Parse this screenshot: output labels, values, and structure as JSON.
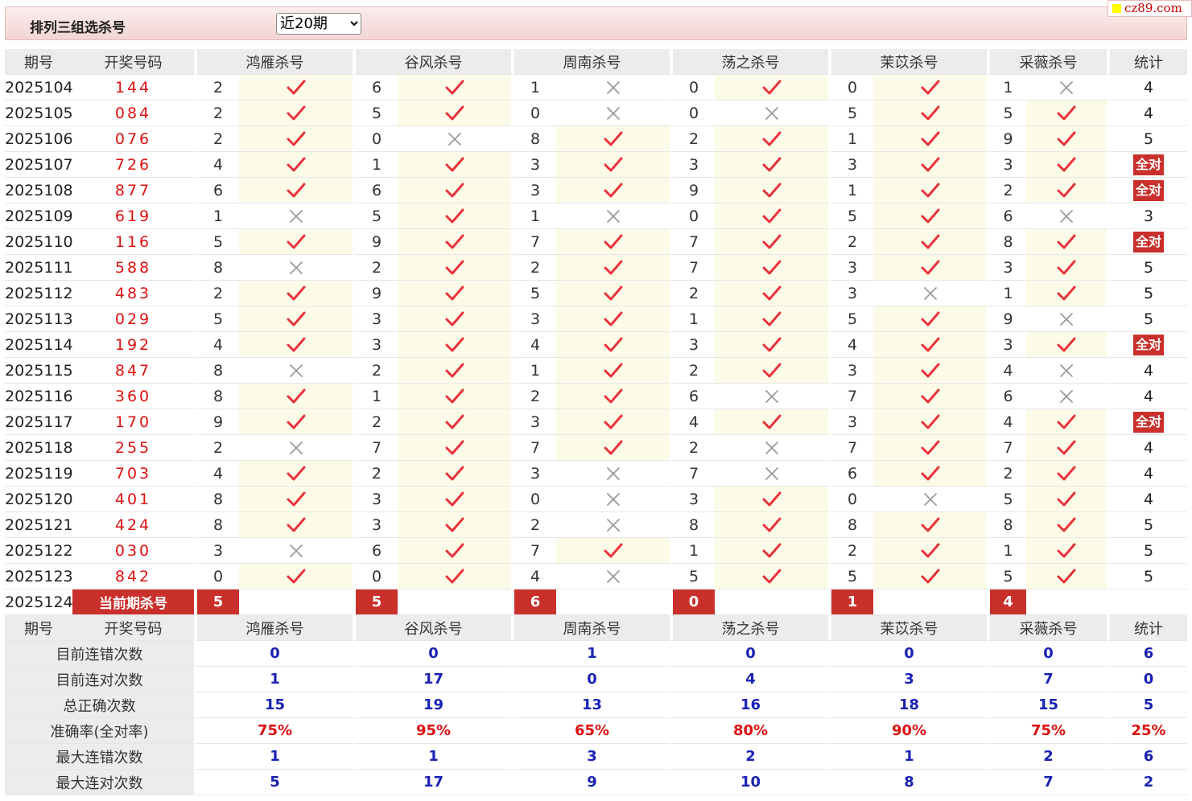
{
  "header": {
    "title": "排列三组选杀号",
    "period_select": "近20期"
  },
  "logo": {
    "text": "cz89.com"
  },
  "table": {
    "col_period": "期号",
    "col_draw": "开奖号码",
    "experts": [
      "鸿雁杀号",
      "谷风杀号",
      "周南杀号",
      "荡之杀号",
      "茉苡杀号",
      "采薇杀号"
    ],
    "col_stat": "统计",
    "all_correct_label": "全对",
    "rows": [
      {
        "period": "2025104",
        "draw": "144",
        "kills": [
          {
            "n": "2",
            "ok": true
          },
          {
            "n": "6",
            "ok": true
          },
          {
            "n": "1",
            "ok": false
          },
          {
            "n": "0",
            "ok": true
          },
          {
            "n": "0",
            "ok": true
          },
          {
            "n": "1",
            "ok": false
          }
        ],
        "stat": "4"
      },
      {
        "period": "2025105",
        "draw": "084",
        "kills": [
          {
            "n": "2",
            "ok": true
          },
          {
            "n": "5",
            "ok": true
          },
          {
            "n": "0",
            "ok": false
          },
          {
            "n": "0",
            "ok": false
          },
          {
            "n": "5",
            "ok": true
          },
          {
            "n": "5",
            "ok": true
          }
        ],
        "stat": "4"
      },
      {
        "period": "2025106",
        "draw": "076",
        "kills": [
          {
            "n": "2",
            "ok": true
          },
          {
            "n": "0",
            "ok": false
          },
          {
            "n": "8",
            "ok": true
          },
          {
            "n": "2",
            "ok": true
          },
          {
            "n": "1",
            "ok": true
          },
          {
            "n": "9",
            "ok": true
          }
        ],
        "stat": "5"
      },
      {
        "period": "2025107",
        "draw": "726",
        "kills": [
          {
            "n": "4",
            "ok": true
          },
          {
            "n": "1",
            "ok": true
          },
          {
            "n": "3",
            "ok": true
          },
          {
            "n": "3",
            "ok": true
          },
          {
            "n": "3",
            "ok": true
          },
          {
            "n": "3",
            "ok": true
          }
        ],
        "stat": "全对"
      },
      {
        "period": "2025108",
        "draw": "877",
        "kills": [
          {
            "n": "6",
            "ok": true
          },
          {
            "n": "6",
            "ok": true
          },
          {
            "n": "3",
            "ok": true
          },
          {
            "n": "9",
            "ok": true
          },
          {
            "n": "1",
            "ok": true
          },
          {
            "n": "2",
            "ok": true
          }
        ],
        "stat": "全对"
      },
      {
        "period": "2025109",
        "draw": "619",
        "kills": [
          {
            "n": "1",
            "ok": false
          },
          {
            "n": "5",
            "ok": true
          },
          {
            "n": "1",
            "ok": false
          },
          {
            "n": "0",
            "ok": true
          },
          {
            "n": "5",
            "ok": true
          },
          {
            "n": "6",
            "ok": false
          }
        ],
        "stat": "3"
      },
      {
        "period": "2025110",
        "draw": "116",
        "kills": [
          {
            "n": "5",
            "ok": true
          },
          {
            "n": "9",
            "ok": true
          },
          {
            "n": "7",
            "ok": true
          },
          {
            "n": "7",
            "ok": true
          },
          {
            "n": "2",
            "ok": true
          },
          {
            "n": "8",
            "ok": true
          }
        ],
        "stat": "全对"
      },
      {
        "period": "2025111",
        "draw": "588",
        "kills": [
          {
            "n": "8",
            "ok": false
          },
          {
            "n": "2",
            "ok": true
          },
          {
            "n": "2",
            "ok": true
          },
          {
            "n": "7",
            "ok": true
          },
          {
            "n": "3",
            "ok": true
          },
          {
            "n": "3",
            "ok": true
          }
        ],
        "stat": "5"
      },
      {
        "period": "2025112",
        "draw": "483",
        "kills": [
          {
            "n": "2",
            "ok": true
          },
          {
            "n": "9",
            "ok": true
          },
          {
            "n": "5",
            "ok": true
          },
          {
            "n": "2",
            "ok": true
          },
          {
            "n": "3",
            "ok": false
          },
          {
            "n": "1",
            "ok": true
          }
        ],
        "stat": "5"
      },
      {
        "period": "2025113",
        "draw": "029",
        "kills": [
          {
            "n": "5",
            "ok": true
          },
          {
            "n": "3",
            "ok": true
          },
          {
            "n": "3",
            "ok": true
          },
          {
            "n": "1",
            "ok": true
          },
          {
            "n": "5",
            "ok": true
          },
          {
            "n": "9",
            "ok": false
          }
        ],
        "stat": "5"
      },
      {
        "period": "2025114",
        "draw": "192",
        "kills": [
          {
            "n": "4",
            "ok": true
          },
          {
            "n": "3",
            "ok": true
          },
          {
            "n": "4",
            "ok": true
          },
          {
            "n": "3",
            "ok": true
          },
          {
            "n": "4",
            "ok": true
          },
          {
            "n": "3",
            "ok": true
          }
        ],
        "stat": "全对"
      },
      {
        "period": "2025115",
        "draw": "847",
        "kills": [
          {
            "n": "8",
            "ok": false
          },
          {
            "n": "2",
            "ok": true
          },
          {
            "n": "1",
            "ok": true
          },
          {
            "n": "2",
            "ok": true
          },
          {
            "n": "3",
            "ok": true
          },
          {
            "n": "4",
            "ok": false
          }
        ],
        "stat": "4"
      },
      {
        "period": "2025116",
        "draw": "360",
        "kills": [
          {
            "n": "8",
            "ok": true
          },
          {
            "n": "1",
            "ok": true
          },
          {
            "n": "2",
            "ok": true
          },
          {
            "n": "6",
            "ok": false
          },
          {
            "n": "7",
            "ok": true
          },
          {
            "n": "6",
            "ok": false
          }
        ],
        "stat": "4"
      },
      {
        "period": "2025117",
        "draw": "170",
        "kills": [
          {
            "n": "9",
            "ok": true
          },
          {
            "n": "2",
            "ok": true
          },
          {
            "n": "3",
            "ok": true
          },
          {
            "n": "4",
            "ok": true
          },
          {
            "n": "3",
            "ok": true
          },
          {
            "n": "4",
            "ok": true
          }
        ],
        "stat": "全对"
      },
      {
        "period": "2025118",
        "draw": "255",
        "kills": [
          {
            "n": "2",
            "ok": false
          },
          {
            "n": "7",
            "ok": true
          },
          {
            "n": "7",
            "ok": true
          },
          {
            "n": "2",
            "ok": false
          },
          {
            "n": "7",
            "ok": true
          },
          {
            "n": "7",
            "ok": true
          }
        ],
        "stat": "4"
      },
      {
        "period": "2025119",
        "draw": "703",
        "kills": [
          {
            "n": "4",
            "ok": true
          },
          {
            "n": "2",
            "ok": true
          },
          {
            "n": "3",
            "ok": false
          },
          {
            "n": "7",
            "ok": false
          },
          {
            "n": "6",
            "ok": true
          },
          {
            "n": "2",
            "ok": true
          }
        ],
        "stat": "4"
      },
      {
        "period": "2025120",
        "draw": "401",
        "kills": [
          {
            "n": "8",
            "ok": true
          },
          {
            "n": "3",
            "ok": true
          },
          {
            "n": "0",
            "ok": false
          },
          {
            "n": "3",
            "ok": true
          },
          {
            "n": "0",
            "ok": false
          },
          {
            "n": "5",
            "ok": true
          }
        ],
        "stat": "4"
      },
      {
        "period": "2025121",
        "draw": "424",
        "kills": [
          {
            "n": "8",
            "ok": true
          },
          {
            "n": "3",
            "ok": true
          },
          {
            "n": "2",
            "ok": false
          },
          {
            "n": "8",
            "ok": true
          },
          {
            "n": "8",
            "ok": true
          },
          {
            "n": "8",
            "ok": true
          }
        ],
        "stat": "5"
      },
      {
        "period": "2025122",
        "draw": "030",
        "kills": [
          {
            "n": "3",
            "ok": false
          },
          {
            "n": "6",
            "ok": true
          },
          {
            "n": "7",
            "ok": true
          },
          {
            "n": "1",
            "ok": true
          },
          {
            "n": "2",
            "ok": true
          },
          {
            "n": "1",
            "ok": true
          }
        ],
        "stat": "5"
      },
      {
        "period": "2025123",
        "draw": "842",
        "kills": [
          {
            "n": "0",
            "ok": true
          },
          {
            "n": "0",
            "ok": true
          },
          {
            "n": "4",
            "ok": false
          },
          {
            "n": "5",
            "ok": true
          },
          {
            "n": "5",
            "ok": true
          },
          {
            "n": "5",
            "ok": true
          }
        ],
        "stat": "5"
      }
    ],
    "current": {
      "period": "2025124",
      "label": "当前期杀号",
      "kills": [
        "5",
        "5",
        "6",
        "0",
        "1",
        "4"
      ]
    },
    "summary": [
      {
        "label": "目前连错次数",
        "values": [
          "0",
          "0",
          "1",
          "0",
          "0",
          "0"
        ],
        "stat": "6",
        "red": false
      },
      {
        "label": "目前连对次数",
        "values": [
          "1",
          "17",
          "0",
          "4",
          "3",
          "7"
        ],
        "stat": "0",
        "red": false
      },
      {
        "label": "总正确次数",
        "values": [
          "15",
          "19",
          "13",
          "16",
          "18",
          "15"
        ],
        "stat": "5",
        "red": false
      },
      {
        "label": "准确率(全对率)",
        "values": [
          "75%",
          "95%",
          "65%",
          "80%",
          "90%",
          "75%"
        ],
        "stat": "25%",
        "red": true
      },
      {
        "label": "最大连错次数",
        "values": [
          "1",
          "1",
          "3",
          "2",
          "1",
          "2"
        ],
        "stat": "6",
        "red": false
      },
      {
        "label": "最大连对次数",
        "values": [
          "5",
          "17",
          "9",
          "10",
          "8",
          "7"
        ],
        "stat": "2",
        "red": false
      }
    ]
  }
}
